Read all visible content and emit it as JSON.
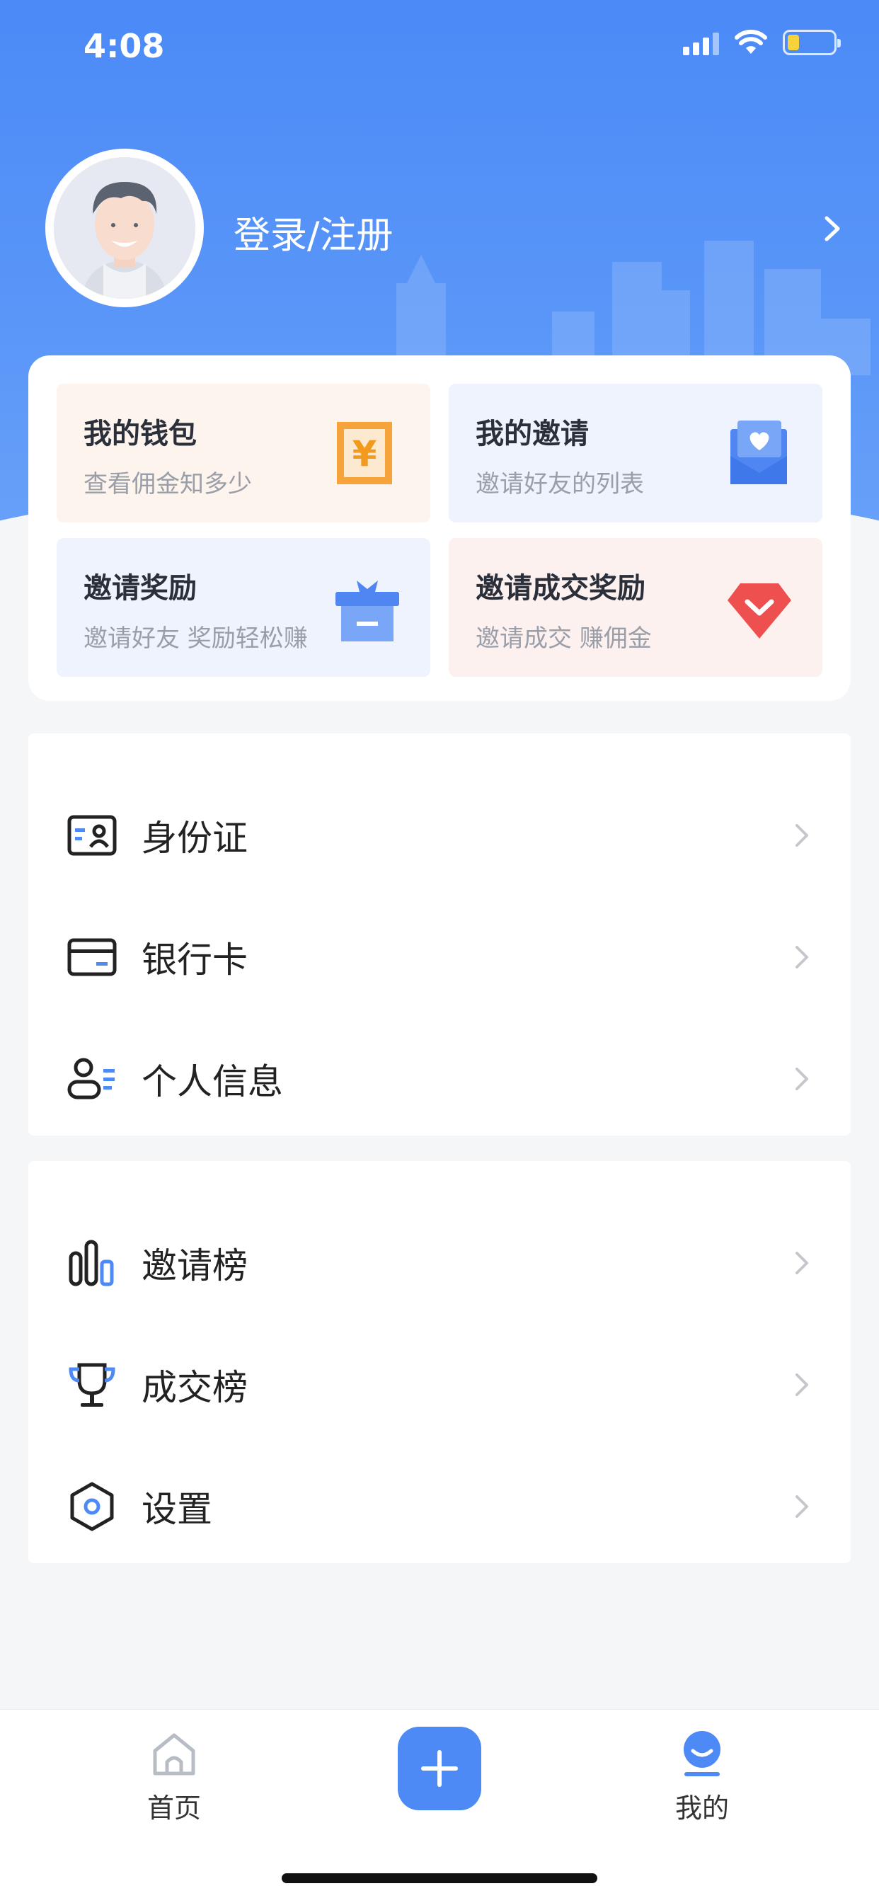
{
  "status_bar": {
    "time": "4:08"
  },
  "profile": {
    "login_label": "登录/注册"
  },
  "feature_cards": [
    {
      "title": "我的钱包",
      "subtitle": "查看佣金知多少",
      "icon": "wallet-yen-icon"
    },
    {
      "title": "我的邀请",
      "subtitle": "邀请好友的列表",
      "icon": "invite-heart-icon"
    },
    {
      "title": "邀请奖励",
      "subtitle": "邀请好友 奖励轻松赚",
      "icon": "gift-box-icon"
    },
    {
      "title": "邀请成交奖励",
      "subtitle": "邀请成交 赚佣金",
      "icon": "diamond-icon"
    }
  ],
  "menu_group_1": [
    {
      "label": "身份证",
      "icon": "id-card-icon"
    },
    {
      "label": "银行卡",
      "icon": "bank-card-icon"
    },
    {
      "label": "个人信息",
      "icon": "personal-info-icon"
    }
  ],
  "menu_group_2": [
    {
      "label": "邀请榜",
      "icon": "bar-chart-icon"
    },
    {
      "label": "成交榜",
      "icon": "trophy-icon"
    },
    {
      "label": "设置",
      "icon": "settings-hexagon-icon"
    }
  ],
  "tabbar": {
    "home_label": "首页",
    "me_label": "我的",
    "active": "我的"
  },
  "colors": {
    "primary": "#4e8af6",
    "header_top": "#4b8af7",
    "wallet_bg": "#fdf4ee",
    "invite_bg": "#eef3fd",
    "deal_bg": "#fdf1ef"
  }
}
